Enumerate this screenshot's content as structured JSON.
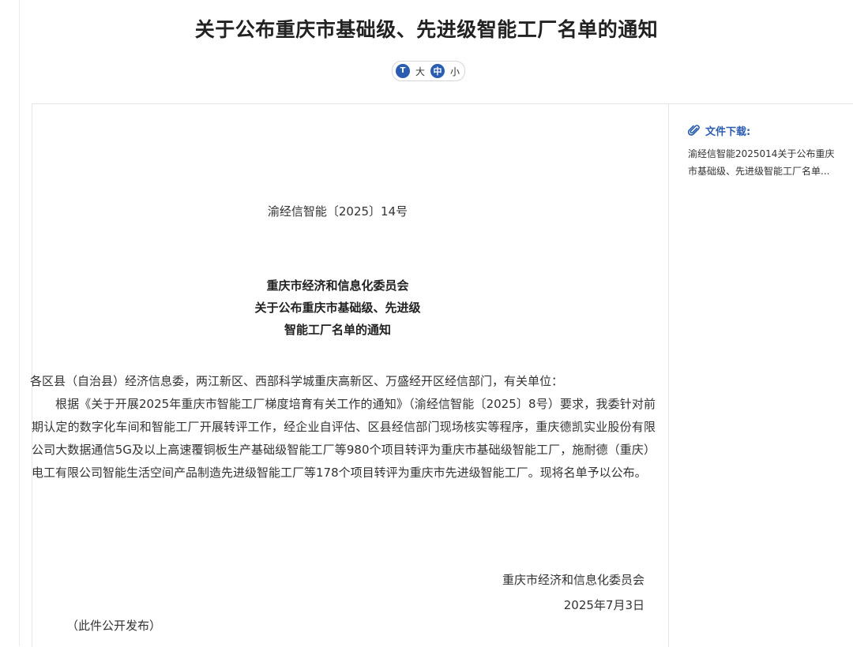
{
  "article": {
    "title": "关于公布重庆市基础级、先进级智能工厂名单的通知",
    "font_size": {
      "icon_glyph": "T",
      "options": [
        "大",
        "中",
        "小"
      ],
      "selected": "中"
    },
    "doc_number": "渝经信智能〔2025〕14号",
    "heading_lines": [
      "重庆市经济和信息化委员会",
      "关于公布重庆市基础级、先进级",
      "智能工厂名单的通知"
    ],
    "addressee": "各区县（自治县）经济信息委，两江新区、西部科学城重庆高新区、万盛经开区经信部门，有关单位：",
    "body": "根据《关于开展2025年重庆市智能工厂梯度培育有关工作的通知》（渝经信智能〔2025〕8号）要求，我委针对前期认定的数字化车间和智能工厂开展转评工作，经企业自评估、区县经信部门现场核实等程序，重庆德凯实业股份有限公司大数据通信5G及以上高速覆铜板生产基础级智能工厂等980个项目转评为重庆市基础级智能工厂，施耐德（重庆）电工有限公司智能生活空间产品制造先进级智能工厂等178个项目转评为重庆市先进级智能工厂。现将名单予以公布。",
    "signoff_org": "重庆市经济和信息化委员会",
    "signoff_date": "2025年7月3日",
    "publish_note": "（此件公开发布）"
  },
  "sidebar": {
    "download_title": "文件下载:",
    "download_file": "渝经信智能2025014关于公布重庆市基础级、先进级智能工厂名单..."
  },
  "colors": {
    "accent": "#2a5db0",
    "text": "#333333",
    "border": "#e6e6e6"
  },
  "icons": {
    "font_size_icon": "font-size-icon",
    "attachment_icon": "paperclip-icon"
  }
}
